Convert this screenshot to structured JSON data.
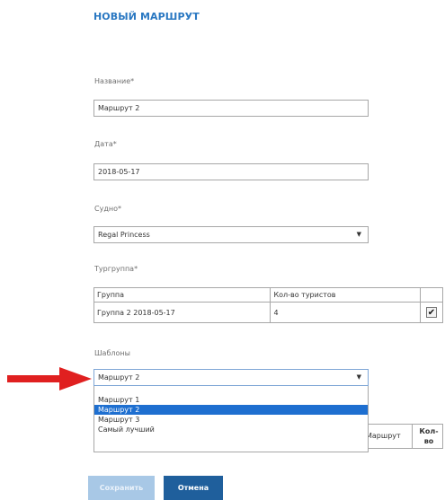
{
  "page": {
    "title": "Новый маршрут"
  },
  "form": {
    "name": {
      "label": "Название*",
      "value": "Маршрут 2"
    },
    "date": {
      "label": "Дата*",
      "value": "2018-05-17"
    },
    "ship": {
      "label": "Судно*",
      "value": "Regal Princess",
      "icon": "chevron-down-icon"
    },
    "tour_group": {
      "label": "Тургруппа*",
      "columns": [
        "Группа",
        "Кол-во туристов",
        ""
      ],
      "rows": [
        {
          "group": "Группа 2 2018-05-17",
          "count": "4",
          "checked": true
        }
      ]
    },
    "templates": {
      "label": "Шаблоны",
      "value": "Маршрут 2",
      "icon": "chevron-down-icon",
      "options": [
        "Маршрут 1",
        "Маршрут 2",
        "Маршрут 3",
        "Самый лучший"
      ],
      "selected_index": 1
    },
    "behind_table": {
      "col1": "Маршрут",
      "col2": "Кол-во"
    }
  },
  "buttons": {
    "save_label": "Сохранить",
    "cancel_label": "Отмена"
  },
  "colors": {
    "accent": "#2a78c2",
    "selected_option": "#1e6fd0",
    "cancel_button": "#1f5f9c",
    "save_button_disabled": "#a8c8e6",
    "pointer_arrow": "#e02020"
  },
  "annotation": {
    "icon": "red-arrow-icon"
  }
}
